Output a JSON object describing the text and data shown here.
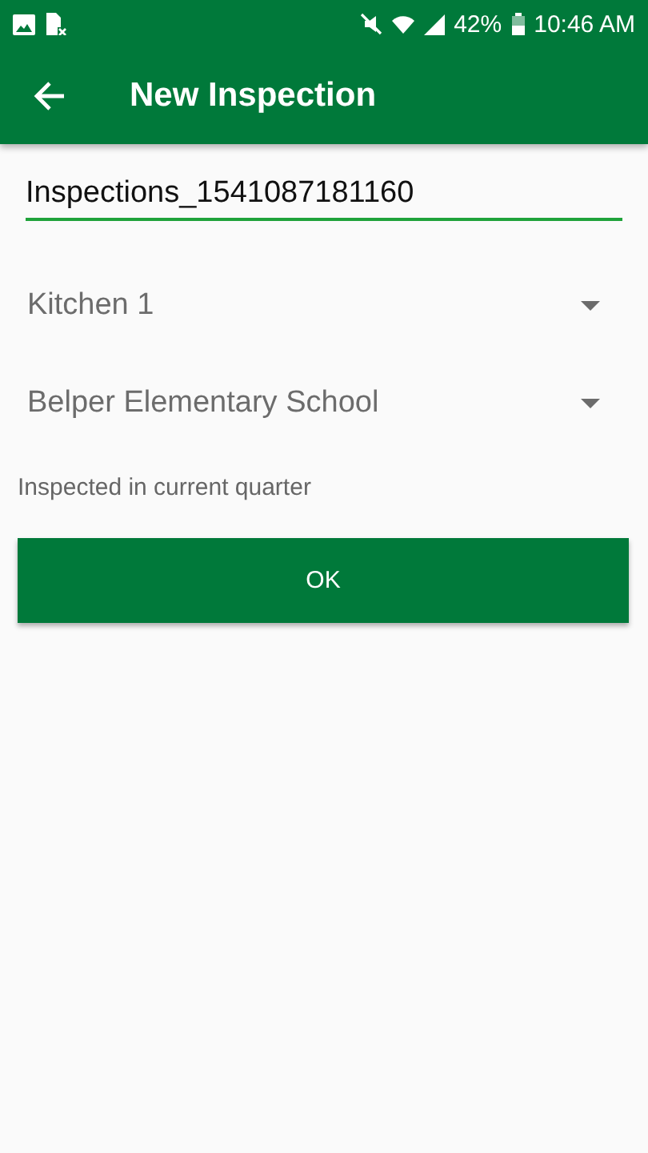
{
  "status_bar": {
    "battery_percent": "42%",
    "time": "10:46 AM"
  },
  "app_bar": {
    "title": "New Inspection"
  },
  "name_field": {
    "value": "Inspections_1541087181160"
  },
  "dropdowns": [
    {
      "value": "Kitchen 1"
    },
    {
      "value": "Belper Elementary School"
    }
  ],
  "note": "Inspected in current quarter",
  "ok_button": {
    "label": "OK"
  }
}
